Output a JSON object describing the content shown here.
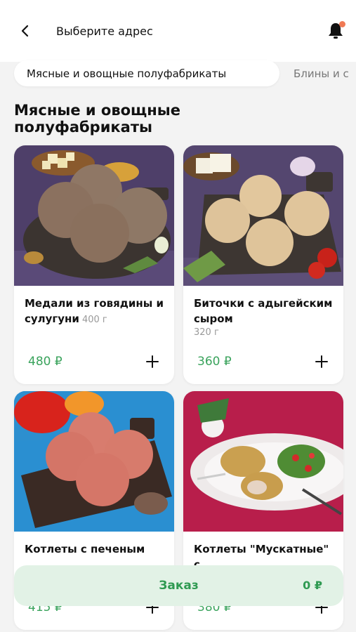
{
  "header": {
    "address_label": "Выберите адрес"
  },
  "categories": [
    {
      "label": "Мясные и овощные полуфабрикаты",
      "active": true
    },
    {
      "label": "Блины и с",
      "active": false
    }
  ],
  "section": {
    "title": "Мясные и овощные полуфабрикаты"
  },
  "products": [
    {
      "name": "Медали из говядины и сулугуни",
      "weight": "400 г",
      "price": "480 ₽"
    },
    {
      "name": "Биточки с адыгейским сыром",
      "weight": "320 г",
      "price": "360 ₽"
    },
    {
      "name": "Котлеты с печеным",
      "weight": "",
      "price": "415 ₽"
    },
    {
      "name": "Котлеты \"Мускатные\" с",
      "weight": "",
      "price": "380 ₽"
    }
  ],
  "order": {
    "label": "Заказ",
    "total": "0 ₽"
  },
  "colors": {
    "accent": "#3aa35c",
    "order_bg": "#e2f2e6",
    "notification_dot": "#f07a55"
  },
  "icons": {
    "back": "back-arrow-icon",
    "bell": "bell-icon",
    "add": "plus-icon"
  }
}
